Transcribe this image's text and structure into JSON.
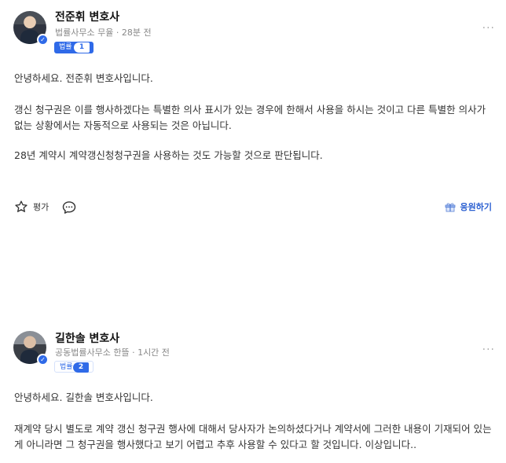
{
  "answers": [
    {
      "name": "전준휘 변호사",
      "meta": "법률사무소 무율 · 28분 전",
      "badge": "법률",
      "rank": "1",
      "more": "···",
      "greeting": "안녕하세요. 전준휘 변호사입니다.",
      "para1": "갱신 청구권은 이를 행사하겠다는 특별한 의사 표시가 있는 경우에 한해서 사용을 하시는 것이고 다른 특별한 의사가 없는 상황에서는 자동적으로 사용되는 것은 아닙니다.",
      "para2": "28년 계약시 계약갱신청청구권을 사용하는 것도 가능할 것으로 판단됩니다.",
      "rate_label": "평가",
      "support_label": "응원하기"
    },
    {
      "name": "길한솔 변호사",
      "meta": "공동법률사무소 한뜰 · 1시간 전",
      "badge": "법률",
      "rank": "2",
      "more": "···",
      "greeting": "안녕하세요. 길한솔 변호사입니다.",
      "para1": "재계약 당시 별도로 계약 갱신 청구권 행사에 대해서 당사자가 논의하셨다거나 계약서에 그러한 내용이 기재되어 있는 게 아니라면 그 청구권을 행사했다고 보기 어렵고 추후 사용할 수 있다고 할 것입니다. 이상입니다.."
    }
  ],
  "icons": {
    "star": "star-icon",
    "comment": "comment-icon",
    "gift": "gift-icon",
    "verified": "check-icon"
  },
  "colors": {
    "accent": "#2f6ae8",
    "support_text": "#2a5fd1"
  }
}
